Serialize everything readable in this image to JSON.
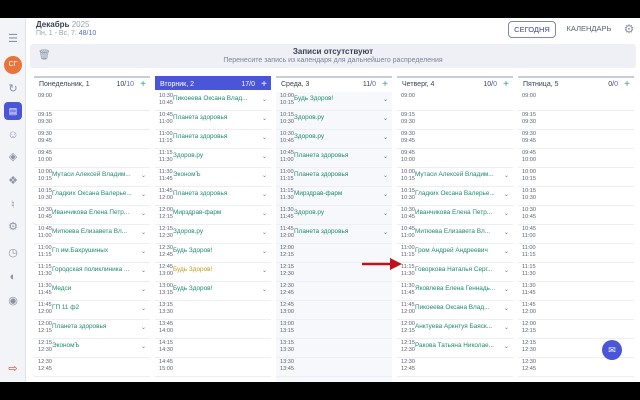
{
  "header": {
    "month": "Декабрь",
    "year": "2025",
    "sub_prefix": "Пн, 1 - Вс, 7.",
    "sub_count": "48/10",
    "today_btn": "СЕГОДНЯ",
    "calendar_btn": "КАЛЕНДАРЬ"
  },
  "rail": {
    "avatar": "СГ"
  },
  "drop": {
    "title": "Записи отсутствуют",
    "subtitle": "Перенесите запись из календаря для дальнейшего распределения"
  },
  "columns": [
    {
      "name": "Понедельник, 1",
      "count_main": "10/",
      "count_accent": "10",
      "slots": [
        {
          "t1": "09:00",
          "t2": "",
          "entry": ""
        },
        {
          "t1": "09:15",
          "t2": "09:30",
          "entry": ""
        },
        {
          "t1": "09:30",
          "t2": "09:45",
          "entry": ""
        },
        {
          "t1": "09:45",
          "t2": "10:00",
          "entry": ""
        },
        {
          "t1": "10:00",
          "t2": "10:15",
          "entry": "Мутаси Алексей Владим..."
        },
        {
          "t1": "10:15",
          "t2": "10:30",
          "entry": "Гладких Оксана Валерье..."
        },
        {
          "t1": "10:30",
          "t2": "10:45",
          "entry": "Иванчикова Елена Петр..."
        },
        {
          "t1": "10:45",
          "t2": "11:00",
          "entry": "Митюева Елизавета Вл..."
        },
        {
          "t1": "11:00",
          "t2": "11:15",
          "entry": "Гп им.Бахрушиных"
        },
        {
          "t1": "11:15",
          "t2": "11:30",
          "entry": "Городская поликлиника ..."
        },
        {
          "t1": "11:30",
          "t2": "11:45",
          "entry": "Медси"
        },
        {
          "t1": "11:45",
          "t2": "12:00",
          "entry": "ГП 11 ф2"
        },
        {
          "t1": "12:00",
          "t2": "12:15",
          "entry": "Планета здоровья"
        },
        {
          "t1": "12:15",
          "t2": "12:30",
          "entry": "ЭкономЪ"
        },
        {
          "t1": "12:30",
          "t2": "12:45",
          "entry": ""
        }
      ]
    },
    {
      "name": "Вторник, 2",
      "count_main": "17/",
      "count_accent": "0",
      "slots": [
        {
          "t1": "10:30",
          "t2": "10:45",
          "entry": "Пикоеева Оксана Влад..."
        },
        {
          "t1": "10:45",
          "t2": "11:00",
          "entry": "Планета здоровья"
        },
        {
          "t1": "11:00",
          "t2": "11:15",
          "entry": "Планета здоровья"
        },
        {
          "t1": "11:15",
          "t2": "11:30",
          "entry": "Здоров.ру"
        },
        {
          "t1": "11:30",
          "t2": "11:45",
          "entry": "ЭкономЪ"
        },
        {
          "t1": "11:45",
          "t2": "12:00",
          "entry": "Планета здоровья"
        },
        {
          "t1": "12:00",
          "t2": "12:15",
          "entry": "Мирздрав-фарм"
        },
        {
          "t1": "12:15",
          "t2": "12:30",
          "entry": "Здоров.ру"
        },
        {
          "t1": "12:30",
          "t2": "12:45",
          "entry": "Будь Здоров!"
        },
        {
          "t1": "12:45",
          "t2": "13:00",
          "entry": "Будь Здоров!",
          "gold": true
        },
        {
          "t1": "13:00",
          "t2": "13:15",
          "entry": "Будь Здоров!"
        },
        {
          "t1": "13:15",
          "t2": "13:30",
          "entry": ""
        },
        {
          "t1": "13:45",
          "t2": "14:00",
          "entry": ""
        },
        {
          "t1": "14:15",
          "t2": "14:30",
          "entry": ""
        },
        {
          "t1": "14:45",
          "t2": "15:00",
          "entry": ""
        }
      ]
    },
    {
      "name": "Среда, 3",
      "count_main": "11/",
      "count_accent": "0",
      "slots": [
        {
          "t1": "10:00",
          "t2": "10:15",
          "entry": "Будь Здоров!"
        },
        {
          "t1": "10:15",
          "t2": "10:30",
          "entry": "Здоров.ру"
        },
        {
          "t1": "10:30",
          "t2": "10:45",
          "entry": "Здоров.ру"
        },
        {
          "t1": "10:45",
          "t2": "11:00",
          "entry": "Планета здоровья"
        },
        {
          "t1": "11:00",
          "t2": "11:15",
          "entry": "Планета здоровья"
        },
        {
          "t1": "11:15",
          "t2": "11:30",
          "entry": "Мирздрав-фарм"
        },
        {
          "t1": "11:30",
          "t2": "11:45",
          "entry": "Здоров.ру"
        },
        {
          "t1": "11:45",
          "t2": "12:00",
          "entry": "Планета здоровья"
        },
        {
          "t1": "12:00",
          "t2": "12:15",
          "entry": ""
        },
        {
          "t1": "12:15",
          "t2": "12:30",
          "entry": ""
        },
        {
          "t1": "12:30",
          "t2": "12:45",
          "entry": ""
        },
        {
          "t1": "12:45",
          "t2": "13:00",
          "entry": ""
        },
        {
          "t1": "13:00",
          "t2": "13:15",
          "entry": ""
        },
        {
          "t1": "13:15",
          "t2": "13:30",
          "entry": ""
        },
        {
          "t1": "13:30",
          "t2": "13:45",
          "entry": ""
        }
      ]
    },
    {
      "name": "Четверг, 4",
      "count_main": "10/",
      "count_accent": "0",
      "slots": [
        {
          "t1": "09:00",
          "t2": "",
          "entry": ""
        },
        {
          "t1": "09:15",
          "t2": "09:30",
          "entry": ""
        },
        {
          "t1": "09:30",
          "t2": "09:45",
          "entry": ""
        },
        {
          "t1": "09:45",
          "t2": "10:00",
          "entry": ""
        },
        {
          "t1": "10:00",
          "t2": "10:15",
          "entry": "Мутаси Алексей Владим..."
        },
        {
          "t1": "10:15",
          "t2": "10:30",
          "entry": "Гладких Оксана Валерье..."
        },
        {
          "t1": "10:30",
          "t2": "10:45",
          "entry": "Иванчикова Елена Петр..."
        },
        {
          "t1": "10:45",
          "t2": "11:00",
          "entry": "Митюева Елизавета Вл..."
        },
        {
          "t1": "11:00",
          "t2": "11:15",
          "entry": "Гром Андрей Андреевич"
        },
        {
          "t1": "11:15",
          "t2": "11:30",
          "entry": "Говоркова Наталья Серг..."
        },
        {
          "t1": "11:30",
          "t2": "11:45",
          "entry": "Яковлева Елена Геннадь..."
        },
        {
          "t1": "11:45",
          "t2": "12:00",
          "entry": "Пикоеева Оксана Влад..."
        },
        {
          "t1": "12:00",
          "t2": "12:15",
          "entry": "Анктуева Аркнтуя Баяск..."
        },
        {
          "t1": "12:15",
          "t2": "12:30",
          "entry": "Ракова Татьяна Николае..."
        },
        {
          "t1": "12:30",
          "t2": "12:45",
          "entry": ""
        }
      ]
    },
    {
      "name": "Пятница, 5",
      "count_main": "0/",
      "count_accent": "0",
      "slots": [
        {
          "t1": "09:00",
          "t2": "",
          "entry": ""
        },
        {
          "t1": "09:15",
          "t2": "09:30",
          "entry": ""
        },
        {
          "t1": "09:30",
          "t2": "09:45",
          "entry": ""
        },
        {
          "t1": "09:45",
          "t2": "10:00",
          "entry": ""
        },
        {
          "t1": "10:00",
          "t2": "10:15",
          "entry": ""
        },
        {
          "t1": "10:15",
          "t2": "10:30",
          "entry": ""
        },
        {
          "t1": "10:30",
          "t2": "10:45",
          "entry": ""
        },
        {
          "t1": "10:45",
          "t2": "11:00",
          "entry": ""
        },
        {
          "t1": "11:00",
          "t2": "11:15",
          "entry": ""
        },
        {
          "t1": "11:15",
          "t2": "11:30",
          "entry": ""
        },
        {
          "t1": "11:30",
          "t2": "11:45",
          "entry": ""
        },
        {
          "t1": "11:45",
          "t2": "12:00",
          "entry": ""
        },
        {
          "t1": "12:00",
          "t2": "12:15",
          "entry": ""
        },
        {
          "t1": "12:15",
          "t2": "12:30",
          "entry": ""
        },
        {
          "t1": "12:30",
          "t2": "12:45",
          "entry": ""
        }
      ]
    }
  ],
  "colors": {
    "accent": "#4a55d8",
    "entry_green": "#1f8a6f",
    "entry_gold": "#c79a1a",
    "arrow": "#c0121b"
  },
  "icons": [
    "menu-icon",
    "refresh-icon",
    "calendar-icon",
    "users-icon",
    "layers-icon",
    "puzzle-icon",
    "bell-icon",
    "settings-icon",
    "clock-icon",
    "chart-icon",
    "location-icon",
    "logout-icon",
    "trash-icon",
    "gear-icon",
    "chat-icon"
  ]
}
